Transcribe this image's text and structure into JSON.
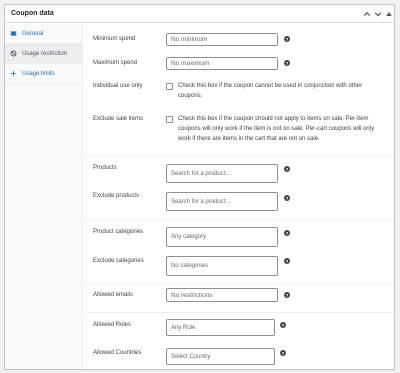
{
  "panel": {
    "title": "Coupon data"
  },
  "header_buttons": [
    "chevron-up-icon",
    "chevron-down-icon",
    "triangle-up-icon"
  ],
  "tabs": [
    {
      "label": "General",
      "icon": "ticket-icon"
    },
    {
      "label": "Usage restriction",
      "icon": "ban-icon"
    },
    {
      "label": "Usage limits",
      "icon": "plus-icon"
    }
  ],
  "fields": {
    "minimum_spend": {
      "label": "Minimum spend",
      "placeholder": "No minimum"
    },
    "maximum_spend": {
      "label": "Maximum spend",
      "placeholder": "No maximum"
    },
    "individual_use": {
      "label": "Individual use only",
      "description": "Check this box if the coupon cannot be used in conjunction with other coupons."
    },
    "exclude_sale": {
      "label": "Exclude sale items",
      "description": "Check this box if the coupon should not apply to items on sale. Per-item coupons will only work if the item is not on sale. Per-cart coupons will only work if there are items in the cart that are not on sale."
    },
    "products": {
      "label": "Products",
      "placeholder": "Search for a product…"
    },
    "exclude_products": {
      "label": "Exclude products",
      "placeholder": "Search for a product…"
    },
    "product_categories": {
      "label": "Product categories",
      "placeholder": "Any category"
    },
    "exclude_categories": {
      "label": "Exclude categories",
      "placeholder": "No categories"
    },
    "allowed_emails": {
      "label": "Allowed emails",
      "placeholder": "No restrictions"
    },
    "allowed_roles": {
      "label": "Allowed Roles",
      "placeholder": "Any Role"
    },
    "allowed_countries": {
      "label": "Allowed Countries",
      "placeholder": "Select Country"
    }
  },
  "help_glyph": "?",
  "colors": {
    "accent": "#2271b1",
    "border": "#c3c4c7",
    "text": "#3c434a"
  }
}
